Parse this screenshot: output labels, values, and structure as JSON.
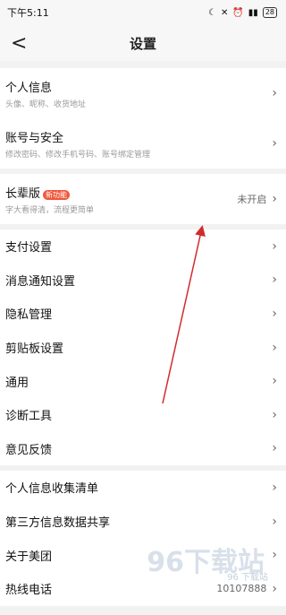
{
  "status": {
    "time": "下午5:11",
    "battery": "28"
  },
  "nav": {
    "title": "设置",
    "back": "<"
  },
  "group1": [
    {
      "title": "个人信息",
      "sub": "头像、昵称、收货地址"
    },
    {
      "title": "账号与安全",
      "sub": "修改密码、修改手机号码、账号绑定管理"
    }
  ],
  "elder": {
    "title": "长辈版",
    "badge": "新功能",
    "sub": "字大看得清，流程更简单",
    "status": "未开启"
  },
  "group3": [
    "支付设置",
    "消息通知设置",
    "隐私管理",
    "剪贴板设置",
    "通用",
    "诊断工具",
    "意见反馈"
  ],
  "group4": [
    "个人信息收集清单",
    "第三方信息数据共享",
    "关于美团",
    "热线电话"
  ],
  "hotline_value": "10107888",
  "watermark": {
    "brand": "96下载站",
    "site": "96 下载站"
  },
  "colors": {
    "accent": "#f0563a",
    "arrow": "#d12b2b"
  }
}
